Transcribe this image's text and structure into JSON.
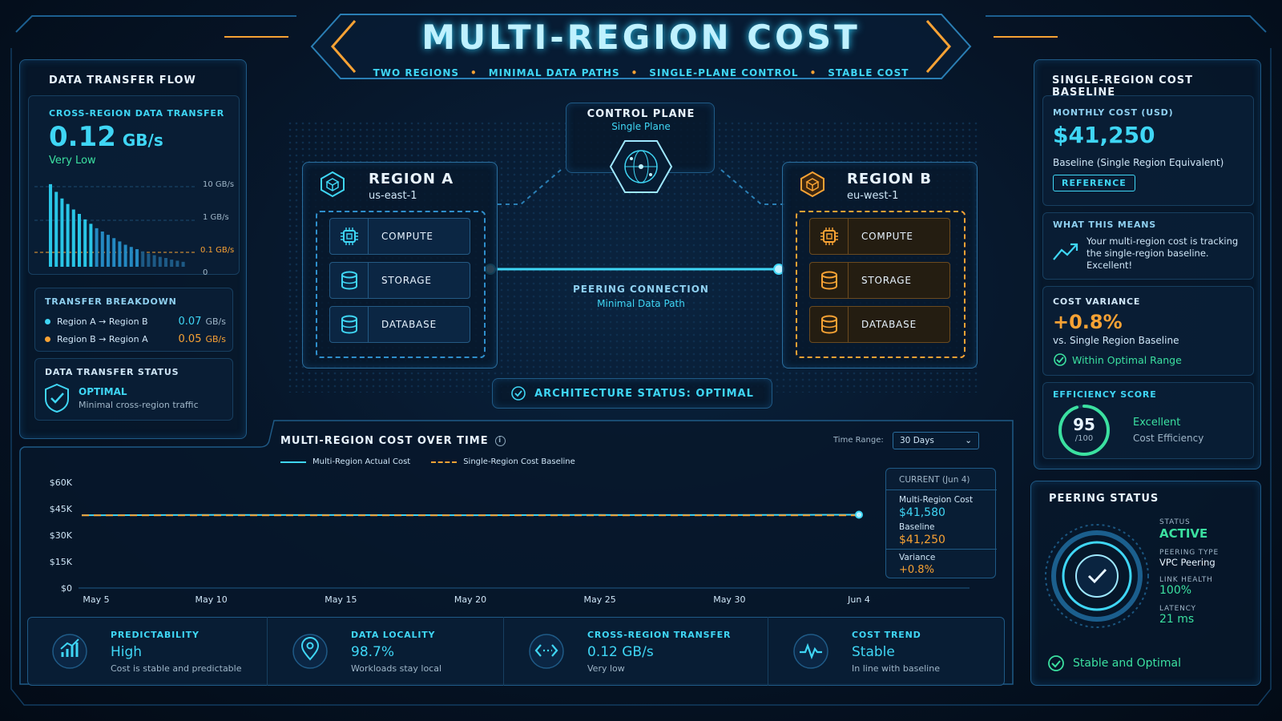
{
  "title": "MULTI-REGION COST",
  "subtitle": [
    "TWO REGIONS",
    "MINIMAL DATA PATHS",
    "SINGLE-PLANE CONTROL",
    "STABLE COST"
  ],
  "colors": {
    "accent": "#3fd6f5",
    "orange": "#f7a234",
    "green": "#3be0a0",
    "panel_border": "#1f5a86"
  },
  "data_transfer": {
    "header": "DATA TRANSFER FLOW",
    "label": "CROSS-REGION DATA TRANSFER",
    "value": "0.12",
    "unit": "GB/s",
    "level": "Very Low",
    "axis": [
      "10 GB/s",
      "1 GB/s",
      "0.1 GB/s",
      "0"
    ],
    "bars": [
      7.5,
      6.8,
      6.2,
      5.7,
      5.2,
      4.8,
      4.3,
      3.9,
      3.5,
      3.2,
      2.9,
      2.6,
      2.3,
      2.0,
      1.8,
      1.6,
      1.4,
      1.2,
      1.05,
      0.9,
      0.8,
      0.65,
      0.55,
      0.45
    ],
    "bars_unit": "log10 GB/s index",
    "breakdown_header": "TRANSFER BREAKDOWN",
    "breakdown": [
      {
        "route": "Region A → Region B",
        "value": "0.07",
        "unit": "GB/s"
      },
      {
        "route": "Region B → Region A",
        "value": "0.05",
        "unit": "GB/s"
      }
    ],
    "status_header": "DATA TRANSFER STATUS",
    "status": "OPTIMAL",
    "status_desc": "Minimal cross-region traffic"
  },
  "control_plane": {
    "title": "CONTROL PLANE",
    "subtitle": "Single Plane"
  },
  "region_a": {
    "name": "REGION A",
    "zone": "us-east-1",
    "services": [
      "COMPUTE",
      "STORAGE",
      "DATABASE"
    ]
  },
  "region_b": {
    "name": "REGION B",
    "zone": "eu-west-1",
    "services": [
      "COMPUTE",
      "STORAGE",
      "DATABASE"
    ]
  },
  "peering_connection": {
    "title": "PEERING CONNECTION",
    "subtitle": "Minimal Data Path"
  },
  "architecture_status": "ARCHITECTURE STATUS: OPTIMAL",
  "baseline": {
    "header": "SINGLE-REGION COST BASELINE",
    "label": "MONTHLY COST (USD)",
    "value": "$41,250",
    "desc": "Baseline (Single Region Equivalent)",
    "badge": "REFERENCE",
    "means_header": "WHAT THIS MEANS",
    "means_text": "Your multi-region cost is tracking the single-region baseline. Excellent!",
    "variance_header": "COST VARIANCE",
    "variance_value": "+0.8%",
    "variance_desc": "vs. Single Region Baseline",
    "variance_status": "Within Optimal Range",
    "efficiency_header": "EFFICIENCY SCORE",
    "efficiency_score": "95",
    "efficiency_max": "/100",
    "efficiency_score_num": 95,
    "efficiency_label": "Excellent",
    "efficiency_desc": "Cost Efficiency"
  },
  "peering_status": {
    "header": "PEERING STATUS",
    "fields": [
      {
        "label": "STATUS",
        "value": "ACTIVE"
      },
      {
        "label": "PEERING TYPE",
        "value": "VPC Peering"
      },
      {
        "label": "LINK HEALTH",
        "value": "100%"
      },
      {
        "label": "LATENCY",
        "value": "21 ms"
      }
    ],
    "footer": "Stable and Optimal"
  },
  "cost_chart": {
    "header": "MULTI-REGION COST OVER TIME",
    "time_range_label": "Time Range:",
    "time_range": "30 Days",
    "legend": [
      "Multi-Region Actual Cost",
      "Single-Region Cost Baseline"
    ],
    "current_header": "CURRENT (Jun 4)",
    "current": [
      {
        "label": "Multi-Region Cost",
        "value": "$41,580"
      },
      {
        "label": "Baseline",
        "value": "$41,250"
      },
      {
        "label": "Variance",
        "value": "+0.8%"
      }
    ]
  },
  "chart_data": {
    "type": "line",
    "title": "MULTI-REGION COST OVER TIME",
    "xlabel": "",
    "ylabel": "",
    "ylim": [
      0,
      60000
    ],
    "yticks": [
      "$0",
      "$15K",
      "$30K",
      "$45K",
      "$60K"
    ],
    "xticks": [
      "May 5",
      "May 10",
      "May 15",
      "May 20",
      "May 25",
      "May 30",
      "Jun 4"
    ],
    "x": [
      "May 5",
      "May 10",
      "May 15",
      "May 20",
      "May 25",
      "May 30",
      "Jun 4"
    ],
    "series": [
      {
        "name": "Multi-Region Actual Cost",
        "values": [
          41300,
          41500,
          41400,
          41300,
          41450,
          41400,
          41580
        ],
        "color": "#3fd6f5",
        "style": "solid"
      },
      {
        "name": "Single-Region Cost Baseline",
        "values": [
          41250,
          41250,
          41250,
          41250,
          41250,
          41250,
          41250
        ],
        "color": "#f7a234",
        "style": "dashed"
      }
    ]
  },
  "kpis": [
    {
      "label": "PREDICTABILITY",
      "value": "High",
      "desc": "Cost is stable and predictable",
      "icon": "chart-up-icon"
    },
    {
      "label": "DATA LOCALITY",
      "value": "98.7%",
      "desc": "Workloads stay local",
      "icon": "location-pin-icon"
    },
    {
      "label": "CROSS-REGION TRANSFER",
      "value": "0.12 GB/s",
      "desc": "Very low",
      "icon": "transfer-arrows-icon"
    },
    {
      "label": "COST TREND",
      "value": "Stable",
      "desc": "In line with baseline",
      "icon": "pulse-icon"
    }
  ]
}
